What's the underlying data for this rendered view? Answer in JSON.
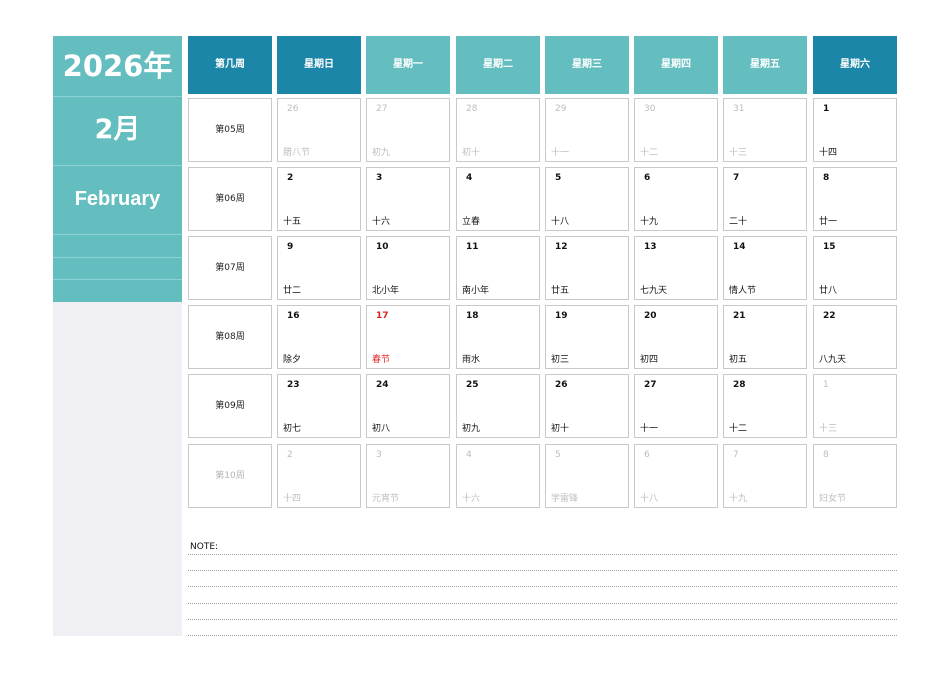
{
  "sidebar": {
    "year": "2026年",
    "month_cn": "2月",
    "month_en": "February"
  },
  "header": {
    "week_col": "第几周",
    "days": [
      "星期日",
      "星期一",
      "星期二",
      "星期三",
      "星期四",
      "星期五",
      "星期六"
    ]
  },
  "colors": {
    "header_dark": "#1b86a8",
    "header_light": "#64bec0",
    "holiday_red": "#e02020",
    "sidebar_bg": "#efeff4"
  },
  "weeks": [
    {
      "label": "第05周",
      "muted": false,
      "days": [
        {
          "num": "26",
          "lunar": "腊八节",
          "muted": true
        },
        {
          "num": "27",
          "lunar": "初九",
          "muted": true
        },
        {
          "num": "28",
          "lunar": "初十",
          "muted": true
        },
        {
          "num": "29",
          "lunar": "十一",
          "muted": true
        },
        {
          "num": "30",
          "lunar": "十二",
          "muted": true
        },
        {
          "num": "31",
          "lunar": "十三",
          "muted": true
        },
        {
          "num": "1",
          "lunar": "十四",
          "muted": false
        }
      ]
    },
    {
      "label": "第06周",
      "muted": false,
      "days": [
        {
          "num": "2",
          "lunar": "十五",
          "muted": false
        },
        {
          "num": "3",
          "lunar": "十六",
          "muted": false
        },
        {
          "num": "4",
          "lunar": "立春",
          "muted": false
        },
        {
          "num": "5",
          "lunar": "十八",
          "muted": false
        },
        {
          "num": "6",
          "lunar": "十九",
          "muted": false
        },
        {
          "num": "7",
          "lunar": "二十",
          "muted": false
        },
        {
          "num": "8",
          "lunar": "廿一",
          "muted": false
        }
      ]
    },
    {
      "label": "第07周",
      "muted": false,
      "days": [
        {
          "num": "9",
          "lunar": "廿二",
          "muted": false
        },
        {
          "num": "10",
          "lunar": "北小年",
          "muted": false
        },
        {
          "num": "11",
          "lunar": "南小年",
          "muted": false
        },
        {
          "num": "12",
          "lunar": "廿五",
          "muted": false
        },
        {
          "num": "13",
          "lunar": "七九天",
          "muted": false
        },
        {
          "num": "14",
          "lunar": "情人节",
          "muted": false
        },
        {
          "num": "15",
          "lunar": "廿八",
          "muted": false
        }
      ]
    },
    {
      "label": "第08周",
      "muted": false,
      "days": [
        {
          "num": "16",
          "lunar": "除夕",
          "muted": false
        },
        {
          "num": "17",
          "lunar": "春节",
          "muted": false,
          "holiday": true
        },
        {
          "num": "18",
          "lunar": "雨水",
          "muted": false
        },
        {
          "num": "19",
          "lunar": "初三",
          "muted": false
        },
        {
          "num": "20",
          "lunar": "初四",
          "muted": false
        },
        {
          "num": "21",
          "lunar": "初五",
          "muted": false
        },
        {
          "num": "22",
          "lunar": "八九天",
          "muted": false
        }
      ]
    },
    {
      "label": "第09周",
      "muted": false,
      "days": [
        {
          "num": "23",
          "lunar": "初七",
          "muted": false
        },
        {
          "num": "24",
          "lunar": "初八",
          "muted": false
        },
        {
          "num": "25",
          "lunar": "初九",
          "muted": false
        },
        {
          "num": "26",
          "lunar": "初十",
          "muted": false
        },
        {
          "num": "27",
          "lunar": "十一",
          "muted": false
        },
        {
          "num": "28",
          "lunar": "十二",
          "muted": false
        },
        {
          "num": "1",
          "lunar": "十三",
          "muted": true
        }
      ]
    },
    {
      "label": "第10周",
      "muted": true,
      "days": [
        {
          "num": "2",
          "lunar": "十四",
          "muted": true
        },
        {
          "num": "3",
          "lunar": "元宵节",
          "muted": true
        },
        {
          "num": "4",
          "lunar": "十六",
          "muted": true
        },
        {
          "num": "5",
          "lunar": "学雷锋",
          "muted": true
        },
        {
          "num": "6",
          "lunar": "十八",
          "muted": true
        },
        {
          "num": "7",
          "lunar": "十九",
          "muted": true
        },
        {
          "num": "8",
          "lunar": "妇女节",
          "muted": true
        }
      ]
    }
  ],
  "note": {
    "label": "NOTE:"
  }
}
